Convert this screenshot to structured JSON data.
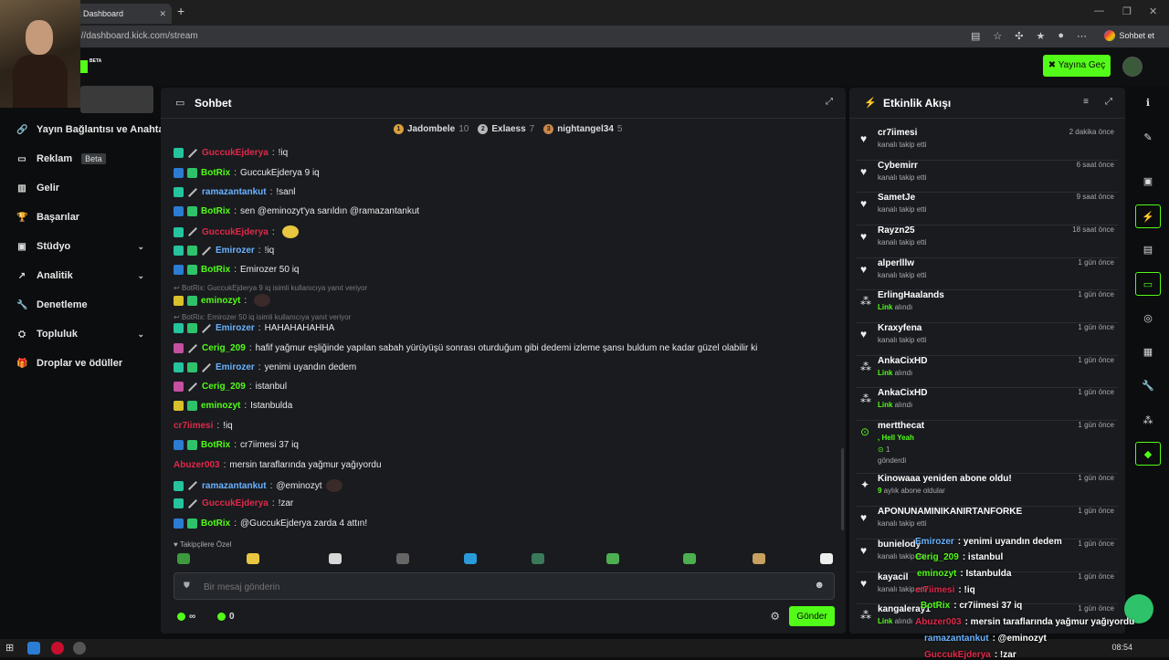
{
  "browser": {
    "tab_title": "k Dashboard",
    "tab_close": "✕",
    "new_tab": "+",
    "url": "://dashboard.kick.com/stream",
    "profile_label": "Sohbet et"
  },
  "appbar": {
    "beta": "BETA",
    "go_live_label": "Yayına Geç"
  },
  "sidebar": {
    "items": [
      {
        "label": "Yayın Bağlantısı ve Anahtarı",
        "icon": "link-icon"
      },
      {
        "label": "Reklam",
        "badge": "Beta",
        "icon": "ad-icon"
      },
      {
        "label": "Gelir",
        "icon": "wallet-icon"
      },
      {
        "label": "Başarılar",
        "icon": "trophy-icon"
      },
      {
        "label": "Stüdyo",
        "icon": "studio-icon",
        "chevron": true
      },
      {
        "label": "Analitik",
        "icon": "chart-icon",
        "chevron": true
      },
      {
        "label": "Denetleme",
        "icon": "wrench-icon"
      },
      {
        "label": "Topluluk",
        "icon": "community-icon",
        "chevron": true
      },
      {
        "label": "Droplar ve ödüller",
        "icon": "gift-icon"
      }
    ]
  },
  "chat": {
    "title": "Sohbet",
    "leaders": [
      {
        "rank": "1",
        "name": "Jadombele",
        "count": "10"
      },
      {
        "rank": "2",
        "name": "Exlaess",
        "count": "7"
      },
      {
        "rank": "3",
        "name": "nightangel34",
        "count": "5"
      }
    ],
    "messages": [
      {
        "user": "GuccukEjderya",
        "color": "#e0294a",
        "text": " !iq"
      },
      {
        "user": "BotRix",
        "color": "#53fc18",
        "text": " GuccukEjderya 9 iq"
      },
      {
        "user": "ramazantankut",
        "color": "#6ab3ff",
        "text": " !sanl"
      },
      {
        "user": "BotRix",
        "color": "#53fc18",
        "text": " sen @eminozyt'ya sarıldın @ramazantankut"
      },
      {
        "user": "GuccukEjderya",
        "color": "#e0294a",
        "text": " "
      },
      {
        "user": "Emirozer",
        "color": "#6ab3ff",
        "text": " !iq"
      },
      {
        "user": "BotRix",
        "color": "#53fc18",
        "text": " Emirozer 50 iq"
      },
      {
        "user": "eminozyt",
        "color": "#53fc18",
        "text": " "
      },
      {
        "user": "Emirozer",
        "color": "#6ab3ff",
        "text": " HAHAHAHAHHA"
      },
      {
        "user": "Cerig_209",
        "color": "#53fc18",
        "text": " hafif yağmur eşliğinde yapılan sabah yürüyüşü sonrası oturduğum gibi dedemi izleme şansı buldum ne kadar güzel olabilir ki"
      },
      {
        "user": "Emirozer",
        "color": "#6ab3ff",
        "text": " yenimi uyandın dedem"
      },
      {
        "user": "Cerig_209",
        "color": "#53fc18",
        "text": " istanbul"
      },
      {
        "user": "eminozyt",
        "color": "#53fc18",
        "text": " Istanbulda"
      },
      {
        "user": "cr7iimesi",
        "color": "#e0294a",
        "text": " !iq"
      },
      {
        "user": "BotRix",
        "color": "#53fc18",
        "text": " cr7iimesi 37 iq"
      },
      {
        "user": "Abuzer003",
        "color": "#e0294a",
        "text": " mersin taraflarında yağmur yağıyordu"
      },
      {
        "user": "ramazantankut",
        "color": "#6ab3ff",
        "text": " @eminozyt"
      },
      {
        "user": "GuccukEjderya",
        "color": "#e0294a",
        "text": " !zar"
      },
      {
        "user": "BotRix",
        "color": "#53fc18",
        "text": " @GuccukEjderya zarda 4 attın!"
      }
    ],
    "replies": [
      "BotRix: GuccukEjderya 9 iq isimli kullanıcıya yanıt veriyor",
      "BotRix: Emirozer 50 iq isimli kullanıcıya yanıt veriyor"
    ],
    "emote_label": "Takipçilere Özel",
    "input_placeholder": "Bir mesaj gönderin",
    "stat_infinity": "∞",
    "stat_count": "0",
    "send_label": "Gönder"
  },
  "feed": {
    "title": "Etkinlik Akışı",
    "events": [
      {
        "name": "cr7iimesi",
        "desc": "kanalı takip etti",
        "time": "2 dakika önce",
        "icon": "heart-icon"
      },
      {
        "name": "Cybemirr",
        "desc": "kanalı takip etti",
        "time": "6 saat önce",
        "icon": "heart-icon"
      },
      {
        "name": "SametJe",
        "desc": "kanalı takip etti",
        "time": "9 saat önce",
        "icon": "heart-icon"
      },
      {
        "name": "Rayzn25",
        "desc": "kanalı takip etti",
        "time": "18 saat önce",
        "icon": "heart-icon"
      },
      {
        "name": "alperlllw",
        "desc": "kanalı takip etti",
        "time": "1 gün önce",
        "icon": "heart-icon"
      },
      {
        "name": "ErlingHaalands",
        "desc_g": "Link",
        "desc": " alındı",
        "time": "1 gün önce",
        "icon": "drop-icon"
      },
      {
        "name": "Kraxyfena",
        "desc": "kanalı takip etti",
        "time": "1 gün önce",
        "icon": "heart-icon"
      },
      {
        "name": "AnkaCixHD",
        "desc_g": "Link",
        "desc": " alındı",
        "time": "1 gün önce",
        "icon": "drop-icon"
      },
      {
        "name": "AnkaCixHD",
        "desc_g": "Link",
        "desc": " alındı",
        "time": "1 gün önce",
        "icon": "drop-icon"
      },
      {
        "name": "mertthecat",
        "desc_g": ", Hell Yeah",
        "desc": "",
        "extra": "1",
        "extra2": "gönderdi",
        "time": "1 gün önce",
        "icon": "kicks-icon"
      },
      {
        "name": "Kinowaaa yeniden abone oldu!",
        "desc_g": "9",
        "desc": " aylık abone oldular",
        "time": "1 gün önce",
        "icon": "star-icon"
      },
      {
        "name": "APONUNAMINIKANIRTANFORKE",
        "desc": "kanalı takip etti",
        "time": "1 gün önce",
        "icon": "heart-icon"
      },
      {
        "name": "bunielody",
        "desc": "kanalı takip etti",
        "time": "1 gün önce",
        "icon": "heart-icon"
      },
      {
        "name": "kayacil",
        "desc": "kanalı takip etti",
        "time": "1 gün önce",
        "icon": "heart-icon"
      },
      {
        "name": "kangaleray1",
        "desc_g": "Link",
        "desc": " alındı",
        "time": "1 gün önce",
        "icon": "drop-icon"
      }
    ]
  },
  "overlay": [
    {
      "user": "Emirozer",
      "color": "#6ab3ff",
      "text": ": yenimi uyandın dedem"
    },
    {
      "user": "Cerig_209",
      "color": "#53fc18",
      "text": ": istanbul"
    },
    {
      "user": "eminozyt",
      "color": "#53fc18",
      "text": ": Istanbulda"
    },
    {
      "user": "cr7iimesi",
      "color": "#e0294a",
      "text": ": !iq"
    },
    {
      "user": "BotRix",
      "color": "#53fc18",
      "text": ": cr7iimesi 37 iq"
    },
    {
      "user": "Abuzer003",
      "color": "#e0294a",
      "text": ": mersin taraflarında yağmur yağıyordu"
    },
    {
      "user": "ramazantankut",
      "color": "#6ab3ff",
      "text": ": @eminozyt"
    },
    {
      "user": "GuccukEjderya",
      "color": "#e0294a",
      "text": ": !zar"
    }
  ],
  "taskbar": {
    "clock": "08:54"
  }
}
